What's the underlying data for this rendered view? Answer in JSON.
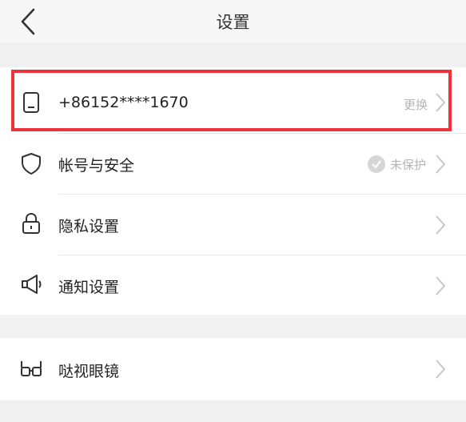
{
  "header": {
    "title": "设置"
  },
  "account_group": {
    "phone": {
      "label": "+86152****1670",
      "action": "更换"
    },
    "security": {
      "label": "帐号与安全",
      "status": "未保护"
    },
    "privacy": {
      "label": "隐私设置"
    },
    "notification": {
      "label": "通知设置"
    }
  },
  "other_group": {
    "glasses": {
      "label": "哒视眼镜"
    }
  },
  "colors": {
    "highlight": "#f0333a",
    "background": "#f2f2f2",
    "row_bg": "#ffffff"
  },
  "icons": [
    "back-arrow-icon",
    "phone-icon",
    "shield-icon",
    "lock-icon",
    "megaphone-icon",
    "glasses-icon",
    "check-circle-icon",
    "chevron-right-icon"
  ]
}
